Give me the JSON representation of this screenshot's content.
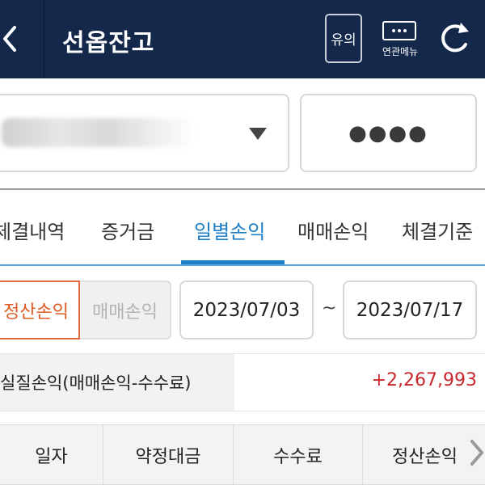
{
  "header": {
    "title": "선옵잔고",
    "notice_label": "유의",
    "menu_label": "연관메뉴",
    "icons": {
      "back": "chevron-left-icon",
      "menu": "more-dots-icon",
      "refresh": "refresh-icon"
    }
  },
  "account": {
    "selected": "",
    "password_mask": "●●●●"
  },
  "tabs": [
    {
      "label": "체결내역"
    },
    {
      "label": "증거금"
    },
    {
      "label": "일별손익",
      "active": true
    },
    {
      "label": "매매손익"
    },
    {
      "label": "체결기준"
    }
  ],
  "filters": {
    "segment_active": "정산손익",
    "segment_inactive": "매매손익",
    "date_from": "2023/07/03",
    "date_separator": "~",
    "date_to": "2023/07/17"
  },
  "summary": {
    "label": "실질손익(매매손익-수수료)",
    "value": "+2,267,993"
  },
  "table": {
    "columns": [
      "일자",
      "약정대금",
      "수수료",
      "정산손익"
    ]
  },
  "colors": {
    "header_bg": "#13284b",
    "accent_blue": "#1f7fc6",
    "accent_orange": "#e05a24",
    "profit_red": "#c8282d"
  }
}
